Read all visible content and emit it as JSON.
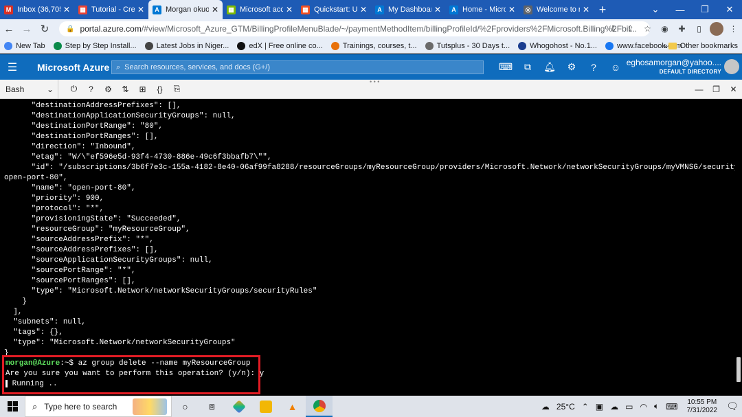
{
  "browser": {
    "tabs": [
      {
        "label": "Inbox (36,705",
        "icon": "gmail-icon",
        "color": "#d93025",
        "glyph": "M"
      },
      {
        "label": "Tutorial - Cre",
        "icon": "google-docs-icon",
        "color": "#ea4335",
        "glyph": "▦"
      },
      {
        "label": "Morgan okuo",
        "icon": "azure-icon",
        "color": "#0078d4",
        "glyph": "A",
        "active": true
      },
      {
        "label": "Microsoft acc",
        "icon": "microsoft-icon",
        "color": "#7fba00",
        "glyph": "▦"
      },
      {
        "label": "Quickstart: U",
        "icon": "microsoft-icon",
        "color": "#f25022",
        "glyph": "▦"
      },
      {
        "label": "My Dashboar",
        "icon": "azure-icon",
        "color": "#0078d4",
        "glyph": "A"
      },
      {
        "label": "Home - Micro",
        "icon": "azure-icon",
        "color": "#0078d4",
        "glyph": "A"
      },
      {
        "label": "Welcome to r",
        "icon": "globe-icon",
        "color": "#5f6368",
        "glyph": "◎"
      }
    ],
    "url_host": "portal.azure.com",
    "url_path": "/#view/Microsoft_Azure_GTM/BillingProfileMenuBlade/~/paymentMethodItem/billingProfileId/%2Fproviders%2FMicrosoft.Billing%2Fbil...",
    "bookmarks": [
      {
        "label": "New Tab",
        "icon": "apps-icon",
        "color": "#4285f4"
      },
      {
        "label": "Step by Step Install...",
        "icon": "bookmark-page-icon",
        "color": "#0a8a4a"
      },
      {
        "label": "Latest Jobs in Niger...",
        "icon": "bookmark-page-icon",
        "color": "#444"
      },
      {
        "label": "edX | Free online co...",
        "icon": "edx-icon",
        "color": "#111"
      },
      {
        "label": "Trainings, courses, t...",
        "icon": "bookmark-page-icon",
        "color": "#e8710a"
      },
      {
        "label": "Tutsplus - 30 Days t...",
        "icon": "bookmark-page-icon",
        "color": "#6a6a6a"
      },
      {
        "label": "Whogohost - No.1...",
        "icon": "bookmark-page-icon",
        "color": "#1a3d8f"
      },
      {
        "label": "www.facebook.com",
        "icon": "facebook-icon",
        "color": "#1877f2"
      }
    ],
    "other_bookmarks": "Other bookmarks"
  },
  "azure": {
    "brand": "Microsoft Azure",
    "search_placeholder": "Search resources, services, and docs (G+/)",
    "user_email": "eghosamorgan@yahoo....",
    "user_directory": "DEFAULT DIRECTORY"
  },
  "shell": {
    "type": "Bash"
  },
  "terminal": {
    "lines": [
      "      \"destinationAddressPrefixes\": [],",
      "      \"destinationApplicationSecurityGroups\": null,",
      "      \"destinationPortRange\": \"80\",",
      "      \"destinationPortRanges\": [],",
      "      \"direction\": \"Inbound\",",
      "      \"etag\": \"W/\\\"ef596e5d-93f4-4730-886e-49c6f3bbafb7\\\"\",",
      "      \"id\": \"/subscriptions/3b6f7e3c-155a-4182-8e40-06af99fa8288/resourceGroups/myResourceGroup/providers/Microsoft.Network/networkSecurityGroups/myVMNSG/securityRules/",
      "open-port-80\",",
      "      \"name\": \"open-port-80\",",
      "      \"priority\": 900,",
      "      \"protocol\": \"*\",",
      "      \"provisioningState\": \"Succeeded\",",
      "      \"resourceGroup\": \"myResourceGroup\",",
      "      \"sourceAddressPrefix\": \"*\",",
      "      \"sourceAddressPrefixes\": [],",
      "      \"sourceApplicationSecurityGroups\": null,",
      "      \"sourcePortRange\": \"*\",",
      "      \"sourcePortRanges\": [],",
      "      \"type\": \"Microsoft.Network/networkSecurityGroups/securityRules\"",
      "    }",
      "  ],",
      "  \"subnets\": null,",
      "  \"tags\": {},",
      "  \"type\": \"Microsoft.Network/networkSecurityGroups\"",
      "}"
    ],
    "prompt_user": "morgan@Azure",
    "prompt_rest": ":~$ az group delete --name myResourceGroup",
    "confirm_line": "Are you sure you want to perform this operation? (y/n): y",
    "running_line": " Running .."
  },
  "taskbar": {
    "search_placeholder": "Type here to search",
    "temperature": "25°C",
    "time": "10:55 PM",
    "date": "7/31/2022"
  }
}
